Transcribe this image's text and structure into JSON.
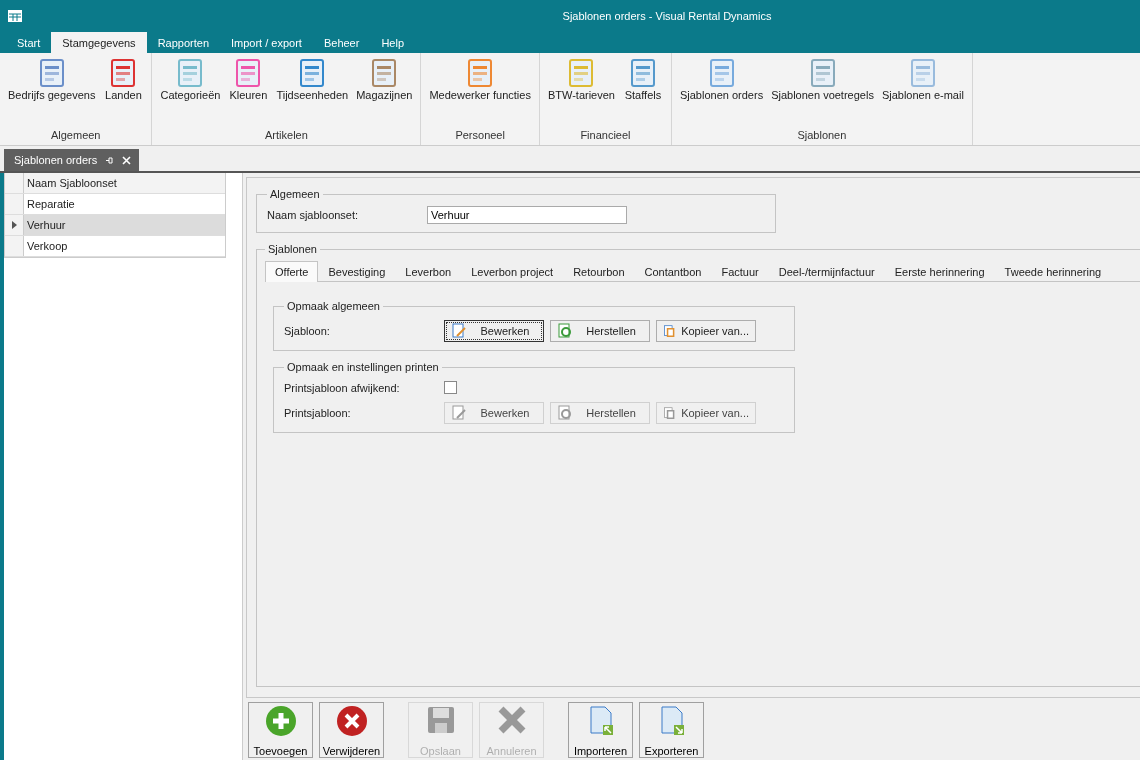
{
  "window": {
    "title": "Sjablonen orders - Visual Rental Dynamics"
  },
  "menu_tabs": [
    {
      "label": "Start",
      "selected": false
    },
    {
      "label": "Stamgegevens",
      "selected": true
    },
    {
      "label": "Rapporten",
      "selected": false
    },
    {
      "label": "Import / export",
      "selected": false
    },
    {
      "label": "Beheer",
      "selected": false
    },
    {
      "label": "Help",
      "selected": false
    }
  ],
  "ribbon_groups": [
    {
      "label": "Algemeen",
      "buttons": [
        "Bedrijfs gegevens",
        "Landen"
      ]
    },
    {
      "label": "Artikelen",
      "buttons": [
        "Categorieën",
        "Kleuren",
        "Tijdseenheden",
        "Magazijnen"
      ]
    },
    {
      "label": "Personeel",
      "buttons": [
        "Medewerker functies"
      ]
    },
    {
      "label": "Financieel",
      "buttons": [
        "BTW-tarieven",
        "Staffels"
      ]
    },
    {
      "label": "Sjablonen",
      "buttons": [
        "Sjablonen orders",
        "Sjablonen voetregels",
        "Sjablonen e-mail"
      ]
    }
  ],
  "document_tab": {
    "title": "Sjablonen orders"
  },
  "grid": {
    "column": "Naam Sjabloonset",
    "rows": [
      {
        "name": "Reparatie",
        "selected": false
      },
      {
        "name": "Verhuur",
        "selected": true
      },
      {
        "name": "Verkoop",
        "selected": false
      }
    ]
  },
  "general": {
    "legend": "Algemeen",
    "label": "Naam sjabloonset:",
    "value": "Verhuur"
  },
  "templates": {
    "legend": "Sjablonen",
    "tabs": [
      {
        "label": "Offerte",
        "selected": true
      },
      {
        "label": "Bevestiging",
        "selected": false
      },
      {
        "label": "Leverbon",
        "selected": false
      },
      {
        "label": "Leverbon project",
        "selected": false
      },
      {
        "label": "Retourbon",
        "selected": false
      },
      {
        "label": "Contantbon",
        "selected": false
      },
      {
        "label": "Factuur",
        "selected": false
      },
      {
        "label": "Deel-/termijnfactuur",
        "selected": false
      },
      {
        "label": "Eerste herinnering",
        "selected": false
      },
      {
        "label": "Tweede herinnering",
        "selected": false
      }
    ],
    "layout_group": {
      "legend": "Opmaak algemeen",
      "label": "Sjabloon:",
      "buttons": [
        {
          "label": "Bewerken",
          "disabled": false,
          "focused": true
        },
        {
          "label": "Herstellen",
          "disabled": false,
          "focused": false
        },
        {
          "label": "Kopieer van...",
          "disabled": false,
          "focused": false
        }
      ]
    },
    "print_group": {
      "legend": "Opmaak en instellingen printen",
      "checkbox_label": "Printsjabloon afwijkend:",
      "checked": false,
      "label": "Printsjabloon:",
      "buttons": [
        {
          "label": "Bewerken",
          "disabled": true,
          "focused": false
        },
        {
          "label": "Herstellen",
          "disabled": true,
          "focused": false
        },
        {
          "label": "Kopieer van...",
          "disabled": true,
          "focused": false
        }
      ]
    }
  },
  "toolbar": [
    {
      "label": "Toevoegen",
      "disabled": false
    },
    {
      "label": "Verwijderen",
      "disabled": false
    },
    {
      "label": "Opslaan",
      "disabled": true
    },
    {
      "label": "Annuleren",
      "disabled": true
    },
    {
      "label": "Importeren",
      "disabled": false
    },
    {
      "label": "Exporteren",
      "disabled": false
    }
  ]
}
